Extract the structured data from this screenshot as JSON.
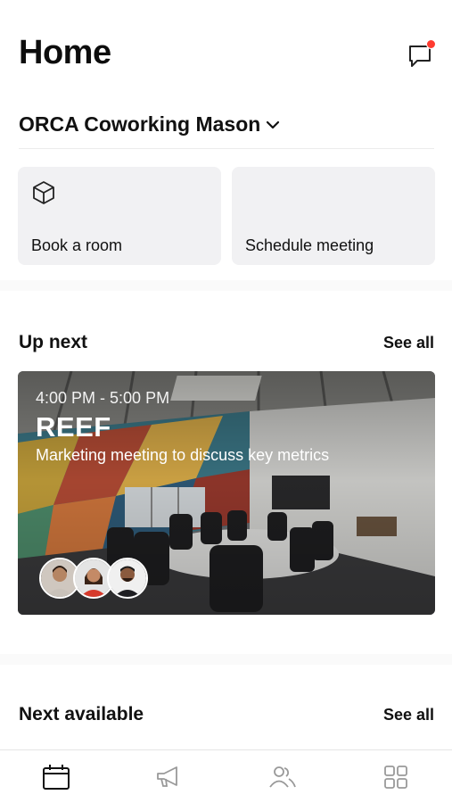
{
  "header": {
    "title": "Home",
    "messages_icon": "chat-bubble-icon",
    "has_notification": true
  },
  "location": {
    "name": "ORCA Coworking Mason",
    "chevron_icon": "chevron-down-icon"
  },
  "quick_actions": [
    {
      "label": "Book a room",
      "icon": "cube-icon"
    },
    {
      "label": "Schedule meeting"
    }
  ],
  "up_next": {
    "title": "Up next",
    "see_all": "See all",
    "meeting": {
      "time": "4:00 PM - 5:00 PM",
      "room": "REEF",
      "description": "Marketing meeting to discuss key metrics",
      "attendee_count": 3
    }
  },
  "next_available": {
    "title": "Next available",
    "see_all": "See all"
  },
  "tabbar": [
    {
      "name": "calendar",
      "icon": "calendar-icon",
      "active": true
    },
    {
      "name": "announcements",
      "icon": "megaphone-icon",
      "active": false
    },
    {
      "name": "people",
      "icon": "people-icon",
      "active": false
    },
    {
      "name": "more",
      "icon": "grid-icon",
      "active": false
    }
  ],
  "colors": {
    "notification": "#ff3b30",
    "tile_bg": "#f1f1f3",
    "text": "#111111"
  }
}
